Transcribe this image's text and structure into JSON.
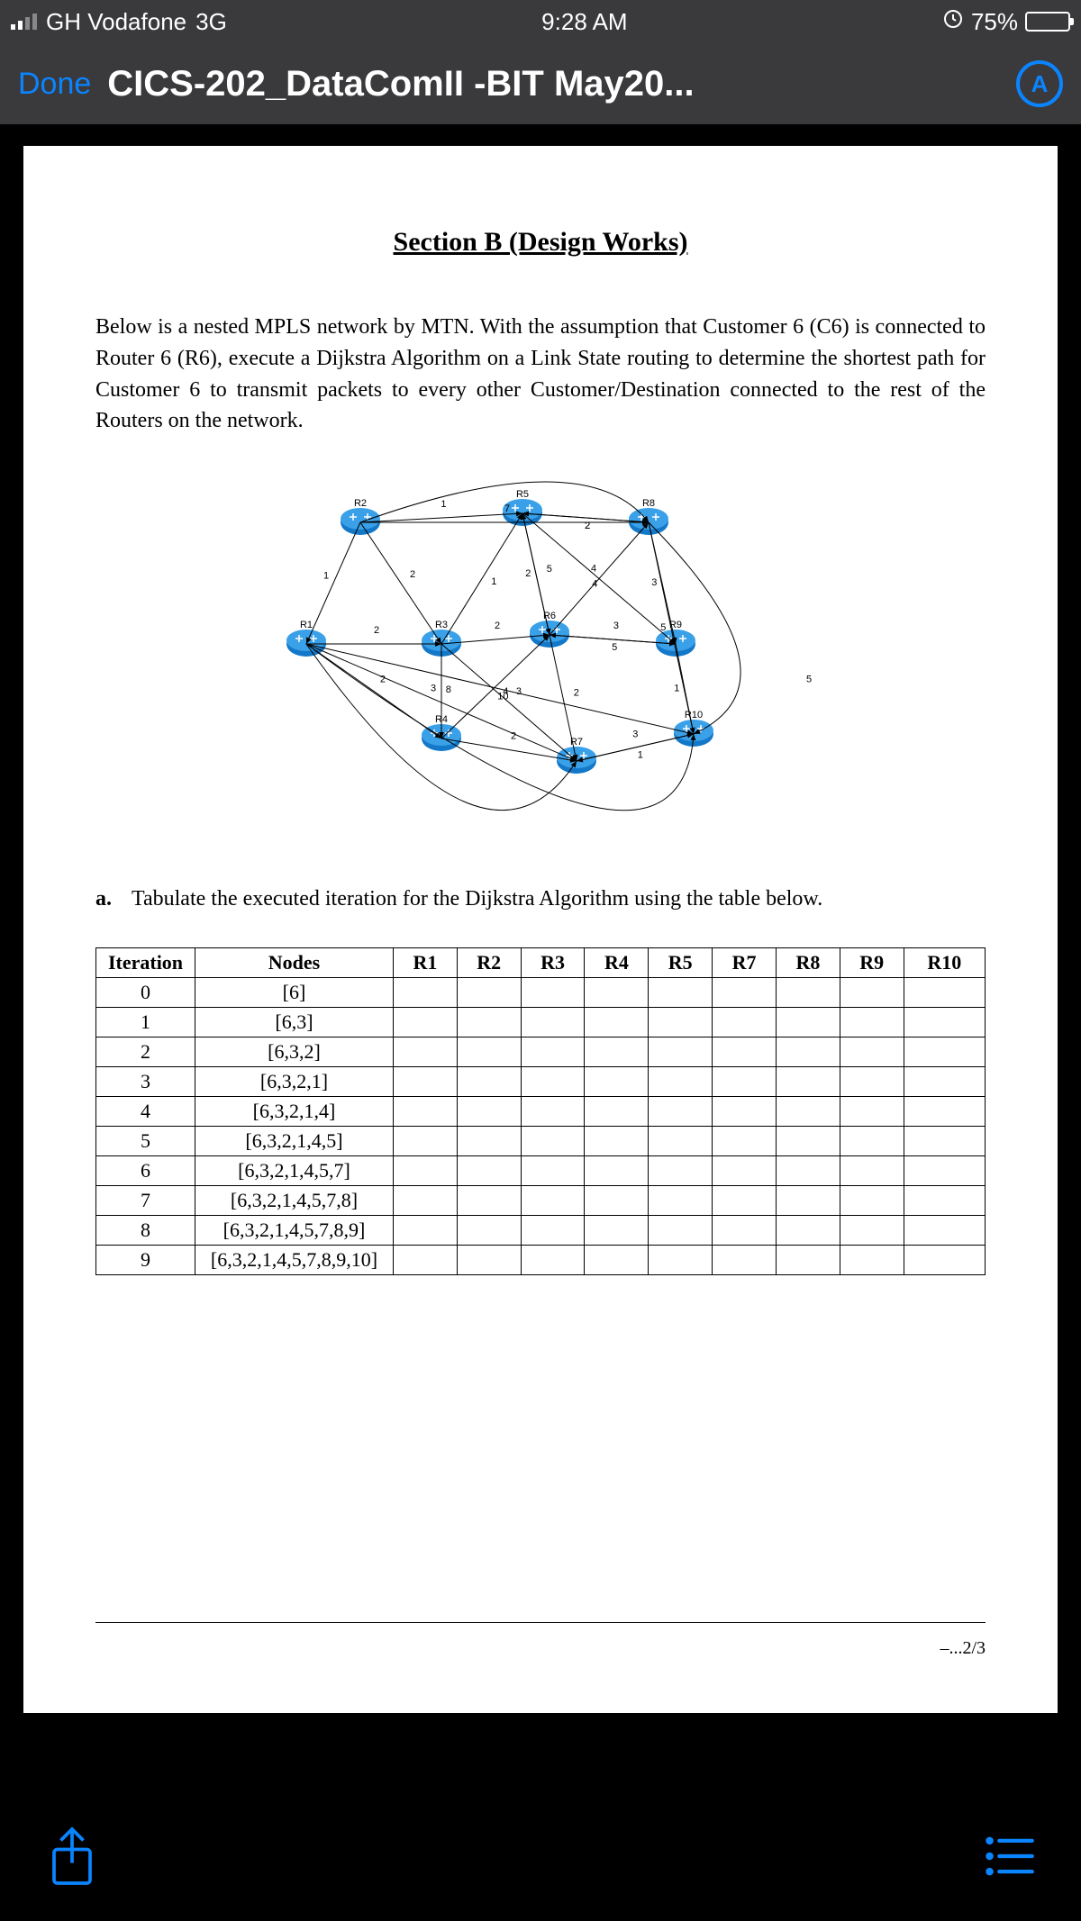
{
  "status": {
    "carrier": "GH Vodafone",
    "network": "3G",
    "time": "9:28 AM",
    "battery_pct": "75%",
    "lock_icon": "⦿"
  },
  "nav": {
    "done": "Done",
    "title": "CICS-202_DataComII -BIT May20...",
    "badge": "A"
  },
  "doc": {
    "section_title": "Section B (Design Works)",
    "intro": "Below is a nested MPLS network by MTN. With the assumption that Customer 6 (C6) is connected to Router 6 (R6), execute a Dijkstra Algorithm on a Link State routing to determine the shortest path for Customer 6 to transmit packets to every other Customer/Destination connected to the rest of the Routers on the network.",
    "diagram": {
      "routers": [
        "R1",
        "R2",
        "R3",
        "R4",
        "R5",
        "R6",
        "R7",
        "R8",
        "R9",
        "R10"
      ],
      "edges": [
        {
          "a": "R2",
          "b": "R5",
          "w": 1
        },
        {
          "a": "R5",
          "b": "R8",
          "w": 2
        },
        {
          "a": "R2",
          "b": "R3",
          "w": 2
        },
        {
          "a": "R2",
          "b": "R1",
          "w": 1
        },
        {
          "a": "R1",
          "b": "R3",
          "w": 2
        },
        {
          "a": "R3",
          "b": "R5",
          "w": 1
        },
        {
          "a": "R3",
          "b": "R6",
          "w": 2
        },
        {
          "a": "R5",
          "b": "R6",
          "w": 2
        },
        {
          "a": "R6",
          "b": "R8",
          "w": 4
        },
        {
          "a": "R8",
          "b": "R9",
          "w": 3
        },
        {
          "a": "R6",
          "b": "R9",
          "w": 3
        },
        {
          "a": "R9",
          "b": "R10",
          "w": 1
        },
        {
          "a": "R6",
          "b": "R7",
          "w": 2
        },
        {
          "a": "R7",
          "b": "R10",
          "w": 1
        },
        {
          "a": "R4",
          "b": "R7",
          "w": 2
        },
        {
          "a": "R3",
          "b": "R4",
          "w": 3
        },
        {
          "a": "R1",
          "b": "R4",
          "w": 2
        },
        {
          "a": "R4",
          "b": "R6",
          "w": 4
        },
        {
          "a": "R3",
          "b": "R7",
          "w": 3
        },
        {
          "a": "R5",
          "b": "R9",
          "w": 4
        },
        {
          "a": "R8",
          "b": "R5",
          "w": 2
        },
        {
          "a": "R6",
          "b": "R5",
          "w": 5
        },
        {
          "a": "R9",
          "b": "R6",
          "w": 5
        },
        {
          "a": "R10",
          "b": "R7",
          "w": 3
        },
        {
          "a": "R2",
          "b": "R8",
          "w": 7
        },
        {
          "a": "R8",
          "b": "R10",
          "w": 5
        },
        {
          "a": "R1",
          "b": "R7",
          "w": 8
        },
        {
          "a": "R1",
          "b": "R10",
          "w": 10
        }
      ]
    },
    "question_a_num": "a.",
    "question_a": "Tabulate the executed iteration for the Dijkstra Algorithm using the table below.",
    "table": {
      "headers": [
        "Iteration",
        "Nodes",
        "R1",
        "R2",
        "R3",
        "R4",
        "R5",
        "R7",
        "R8",
        "R9",
        "R10"
      ],
      "rows": [
        {
          "iter": "0",
          "nodes": "[6]"
        },
        {
          "iter": "1",
          "nodes": "[6,3]"
        },
        {
          "iter": "2",
          "nodes": "[6,3,2]"
        },
        {
          "iter": "3",
          "nodes": "[6,3,2,1]"
        },
        {
          "iter": "4",
          "nodes": "[6,3,2,1,4]"
        },
        {
          "iter": "5",
          "nodes": "[6,3,2,1,4,5]"
        },
        {
          "iter": "6",
          "nodes": "[6,3,2,1,4,5,7]"
        },
        {
          "iter": "7",
          "nodes": "[6,3,2,1,4,5,7,8]"
        },
        {
          "iter": "8",
          "nodes": "[6,3,2,1,4,5,7,8,9]"
        },
        {
          "iter": "9",
          "nodes": "[6,3,2,1,4,5,7,8,9,10]"
        }
      ]
    },
    "page_num": "–...2/3"
  }
}
